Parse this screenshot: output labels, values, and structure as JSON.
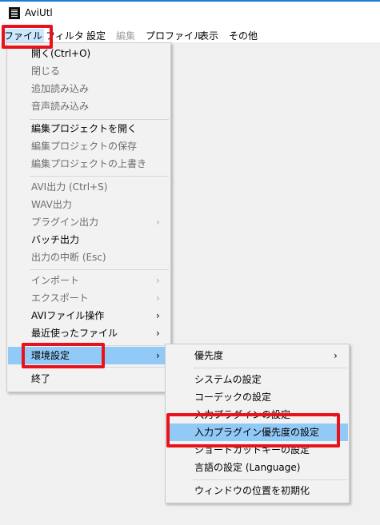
{
  "window": {
    "title": "AviUtl",
    "icon": "film-icon"
  },
  "menubar": [
    {
      "label": "ファイル",
      "state": "active"
    },
    {
      "label": "フィルタ",
      "state": "normal"
    },
    {
      "label": "設定",
      "state": "normal"
    },
    {
      "label": "編集",
      "state": "disabled"
    },
    {
      "label": "プロファイル",
      "state": "normal"
    },
    {
      "label": "表示",
      "state": "normal"
    },
    {
      "label": "その他",
      "state": "normal"
    }
  ],
  "file_menu": [
    {
      "label": "開く(Ctrl+O)",
      "disabled": false
    },
    {
      "label": "閉じる",
      "disabled": true
    },
    {
      "label": "追加読み込み",
      "disabled": true
    },
    {
      "label": "音声読み込み",
      "disabled": true
    },
    {
      "label": "編集プロジェクトを開く",
      "disabled": false
    },
    {
      "label": "編集プロジェクトの保存",
      "disabled": true
    },
    {
      "label": "編集プロジェクトの上書き",
      "disabled": true
    },
    {
      "label": "AVI出力 (Ctrl+S)",
      "disabled": true
    },
    {
      "label": "WAV出力",
      "disabled": true
    },
    {
      "label": "プラグイン出力",
      "disabled": true,
      "submenu": true
    },
    {
      "label": "バッチ出力",
      "disabled": false
    },
    {
      "label": "出力の中断 (Esc)",
      "disabled": true
    },
    {
      "label": "インポート",
      "disabled": true,
      "submenu": true
    },
    {
      "label": "エクスポート",
      "disabled": true,
      "submenu": true
    },
    {
      "label": "AVIファイル操作",
      "disabled": false,
      "submenu": true
    },
    {
      "label": "最近使ったファイル",
      "disabled": false,
      "submenu": true
    },
    {
      "label": "環境設定",
      "disabled": false,
      "submenu": true,
      "highlighted": true
    },
    {
      "label": "終了",
      "disabled": false
    }
  ],
  "settings_submenu": [
    {
      "label": "優先度",
      "submenu": true
    },
    {
      "label": "システムの設定"
    },
    {
      "label": "コーデックの設定"
    },
    {
      "label": "入力プラグインの設定",
      "submenu": true
    },
    {
      "label": "入力プラグイン優先度の設定",
      "highlighted": true
    },
    {
      "label": "ショートカットキーの設定"
    },
    {
      "label": "言語の設定 (Language)"
    },
    {
      "label": "ウィンドウの位置を初期化"
    }
  ],
  "submenu_arrow": "›",
  "annotation_color": "#e8121b"
}
